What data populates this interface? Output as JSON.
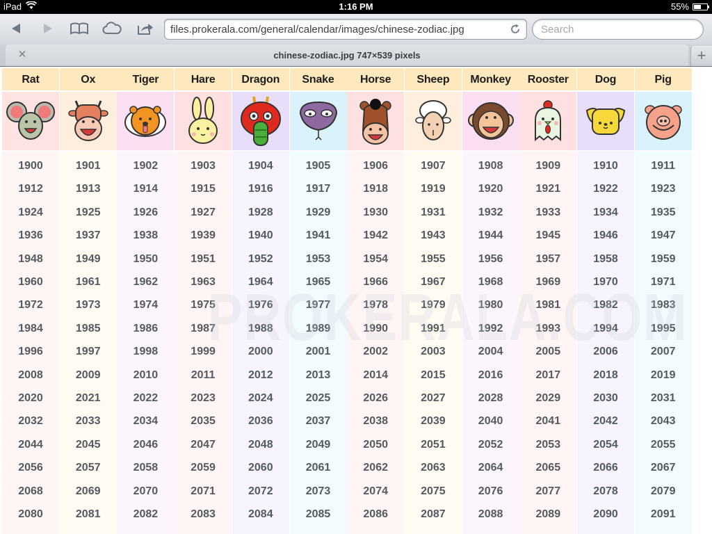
{
  "status_bar": {
    "device": "iPad",
    "time": "1:16 PM",
    "battery_percent_label": "55%",
    "battery_level": 0.55
  },
  "toolbar": {
    "url": "files.prokerala.com/general/calendar/images/chinese-zodiac.jpg",
    "search_placeholder": "Search",
    "search_value": "",
    "icons": [
      "back-arrow-icon",
      "forward-arrow-icon",
      "bookmarks-book-icon",
      "icloud-tabs-icon",
      "share-icon",
      "reload-icon"
    ]
  },
  "tab": {
    "title": "chinese-zodiac.jpg 747×539 pixels",
    "close_icon": "close-icon",
    "add_icon": "plus-icon"
  },
  "image": {
    "watermark": "PROKERALA.COM",
    "animals": [
      {
        "name": "Rat",
        "icon": "rat-face-icon",
        "bg": "#fde3e1",
        "light": "#fef6f4",
        "years": [
          1900,
          1912,
          1924,
          1936,
          1948,
          1960,
          1972,
          1984,
          1996,
          2008,
          2020,
          2032,
          2044,
          2056,
          2068,
          2080
        ]
      },
      {
        "name": "Ox",
        "icon": "ox-face-icon",
        "bg": "#fdeedd",
        "light": "#fffaf2",
        "years": [
          1901,
          1913,
          1925,
          1937,
          1949,
          1961,
          1973,
          1985,
          1997,
          2009,
          2021,
          2033,
          2045,
          2057,
          2069,
          2081
        ]
      },
      {
        "name": "Tiger",
        "icon": "tiger-face-icon",
        "bg": "#fbe0f4",
        "light": "#fdf5fc",
        "years": [
          1902,
          1914,
          1926,
          1938,
          1950,
          1962,
          1974,
          1986,
          1998,
          2010,
          2022,
          2034,
          2046,
          2058,
          2070,
          2082
        ]
      },
      {
        "name": "Hare",
        "icon": "hare-face-icon",
        "bg": "#fde1e1",
        "light": "#fef5f4",
        "years": [
          1903,
          1915,
          1927,
          1939,
          1951,
          1963,
          1975,
          1987,
          1999,
          2011,
          2023,
          2035,
          2047,
          2059,
          2071,
          2083
        ]
      },
      {
        "name": "Dragon",
        "icon": "dragon-face-icon",
        "bg": "#e8def9",
        "light": "#f7f4fe",
        "years": [
          1904,
          1916,
          1928,
          1940,
          1952,
          1964,
          1976,
          1988,
          2000,
          2012,
          2024,
          2036,
          2048,
          2060,
          2072,
          2084
        ]
      },
      {
        "name": "Snake",
        "icon": "snake-face-icon",
        "bg": "#daf3fb",
        "light": "#f2fbfe",
        "years": [
          1905,
          1917,
          1929,
          1941,
          1953,
          1965,
          1977,
          1989,
          2001,
          2013,
          2025,
          2037,
          2049,
          2061,
          2073,
          2085
        ]
      },
      {
        "name": "Horse",
        "icon": "horse-face-icon",
        "bg": "#fde1e1",
        "light": "#fef5f4",
        "years": [
          1906,
          1918,
          1930,
          1942,
          1954,
          1966,
          1978,
          1990,
          2002,
          2014,
          2026,
          2038,
          2050,
          2062,
          2074,
          2086
        ]
      },
      {
        "name": "Sheep",
        "icon": "sheep-face-icon",
        "bg": "#fdeedd",
        "light": "#fffaf2",
        "years": [
          1907,
          1919,
          1931,
          1943,
          1955,
          1967,
          1979,
          1991,
          2003,
          2015,
          2027,
          2039,
          2051,
          2063,
          2075,
          2087
        ]
      },
      {
        "name": "Monkey",
        "icon": "monkey-face-icon",
        "bg": "#fbe0f4",
        "light": "#fdf5fc",
        "years": [
          1908,
          1920,
          1932,
          1944,
          1956,
          1968,
          1980,
          1992,
          2004,
          2016,
          2028,
          2040,
          2052,
          2064,
          2076,
          2088
        ]
      },
      {
        "name": "Rooster",
        "icon": "rooster-face-icon",
        "bg": "#fde1e1",
        "light": "#fef5f4",
        "years": [
          1909,
          1921,
          1933,
          1945,
          1957,
          1969,
          1981,
          1993,
          2005,
          2017,
          2029,
          2041,
          2053,
          2065,
          2077,
          2089
        ]
      },
      {
        "name": "Dog",
        "icon": "dog-face-icon",
        "bg": "#e8def9",
        "light": "#f7f4fe",
        "years": [
          1910,
          1922,
          1934,
          1946,
          1958,
          1970,
          1982,
          1994,
          2006,
          2018,
          2030,
          2042,
          2054,
          2066,
          2078,
          2090
        ]
      },
      {
        "name": "Pig",
        "icon": "pig-face-icon",
        "bg": "#daf3fb",
        "light": "#f2fbfe",
        "years": [
          1911,
          1923,
          1935,
          1947,
          1959,
          1971,
          1983,
          1995,
          2007,
          2019,
          2031,
          2043,
          2055,
          2067,
          2079,
          2091
        ]
      }
    ]
  }
}
